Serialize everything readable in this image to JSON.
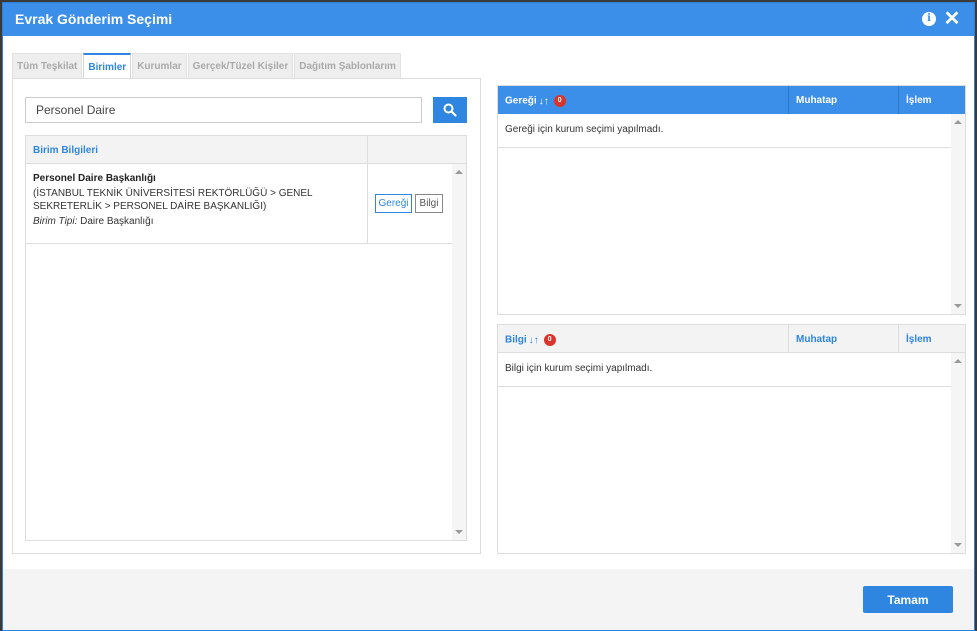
{
  "dialog": {
    "title": "Evrak Gönderim Seçimi",
    "info_icon": "i",
    "close_icon": "✕"
  },
  "tabs": [
    {
      "label": "Tüm Teşkilat",
      "active": false
    },
    {
      "label": "Birimler",
      "active": true
    },
    {
      "label": "Kurumlar",
      "active": false
    },
    {
      "label": "Gerçek/Tüzel Kişiler",
      "active": false
    },
    {
      "label": "Dağıtım Şablonlarım",
      "active": false
    }
  ],
  "search": {
    "value": "Personel Daire"
  },
  "grid": {
    "header": "Birim Bilgileri",
    "rows": [
      {
        "title": "Personel Daire Başkanlığı",
        "path": "(İSTANBUL TEKNİK ÜNİVERSİTESİ REKTÖRLÜĞÜ > GENEL SEKRETERLİK > PERSONEL DAİRE BAŞKANLIĞI)",
        "type_label": "Birim Tipi:",
        "type_value": "Daire Başkanlığı",
        "btn_gereg": "Gereği",
        "btn_bilgi": "Bilgi"
      }
    ]
  },
  "gereg_panel": {
    "title": "Gereği",
    "sort_icon": "↓↑",
    "count": "0",
    "col_muhatap": "Muhatap",
    "col_islem": "İşlem",
    "empty_message": "Gereği için kurum seçimi yapılmadı."
  },
  "bilgi_panel": {
    "title": "Bilgi",
    "sort_icon": "↓↑",
    "count": "0",
    "col_muhatap": "Muhatap",
    "col_islem": "İşlem",
    "empty_message": "Bilgi için kurum seçimi yapılmadı."
  },
  "footer": {
    "ok_label": "Tamam"
  },
  "colors": {
    "primary": "#3b8fe8",
    "badge": "#d9342b"
  }
}
